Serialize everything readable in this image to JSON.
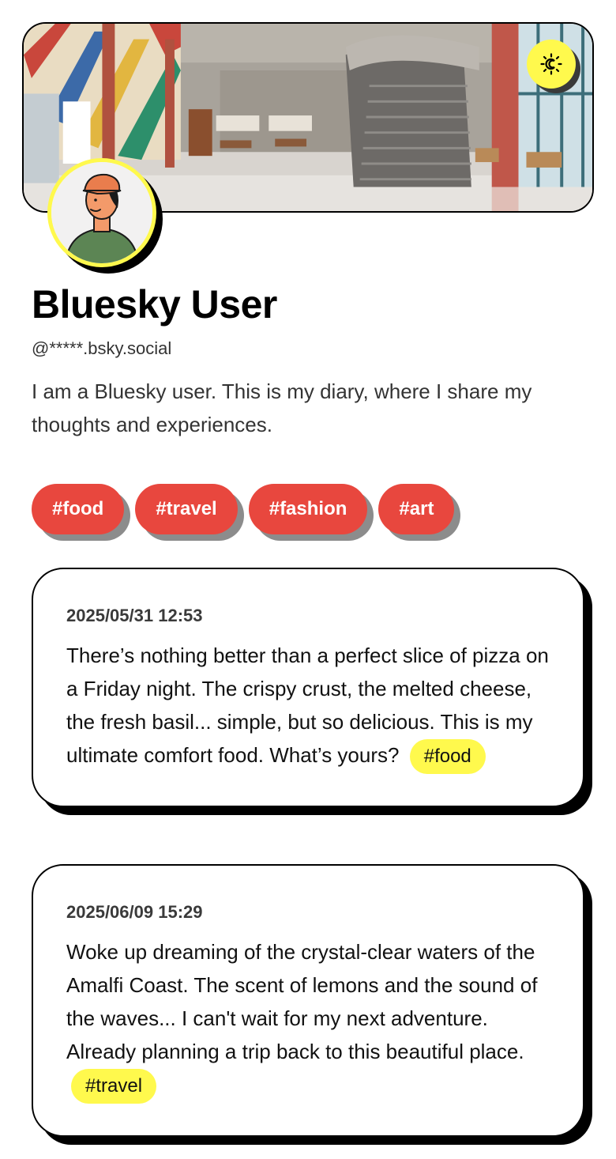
{
  "profile": {
    "display_name": "Bluesky User",
    "handle": "@*****.bsky.social",
    "bio": "I am a Bluesky user. This is my diary, where I share my thoughts and experiences."
  },
  "theme_toggle": {
    "icon": "sun-moon-icon"
  },
  "colors": {
    "accent_yellow": "#fff94d",
    "tag_red": "#e8473e",
    "tag_shadow": "#8c8c8c",
    "ink": "#000000"
  },
  "tags": [
    {
      "label": "#food"
    },
    {
      "label": "#travel"
    },
    {
      "label": "#fashion"
    },
    {
      "label": "#art"
    }
  ],
  "posts": [
    {
      "date": "2025/05/31 12:53",
      "text": "There’s nothing better than a perfect slice of pizza on a Friday night. The crispy crust, the melted cheese, the fresh basil... simple, but so delicious. This is my ultimate comfort food. What’s yours?",
      "tag": "#food"
    },
    {
      "date": "2025/06/09 15:29",
      "text": "Woke up dreaming of the crystal-clear waters of the Amalfi Coast. The scent of lemons and the sound of the waves... I can't wait for my next adventure. Already planning a trip back to this beautiful place.",
      "tag": "#travel"
    }
  ]
}
